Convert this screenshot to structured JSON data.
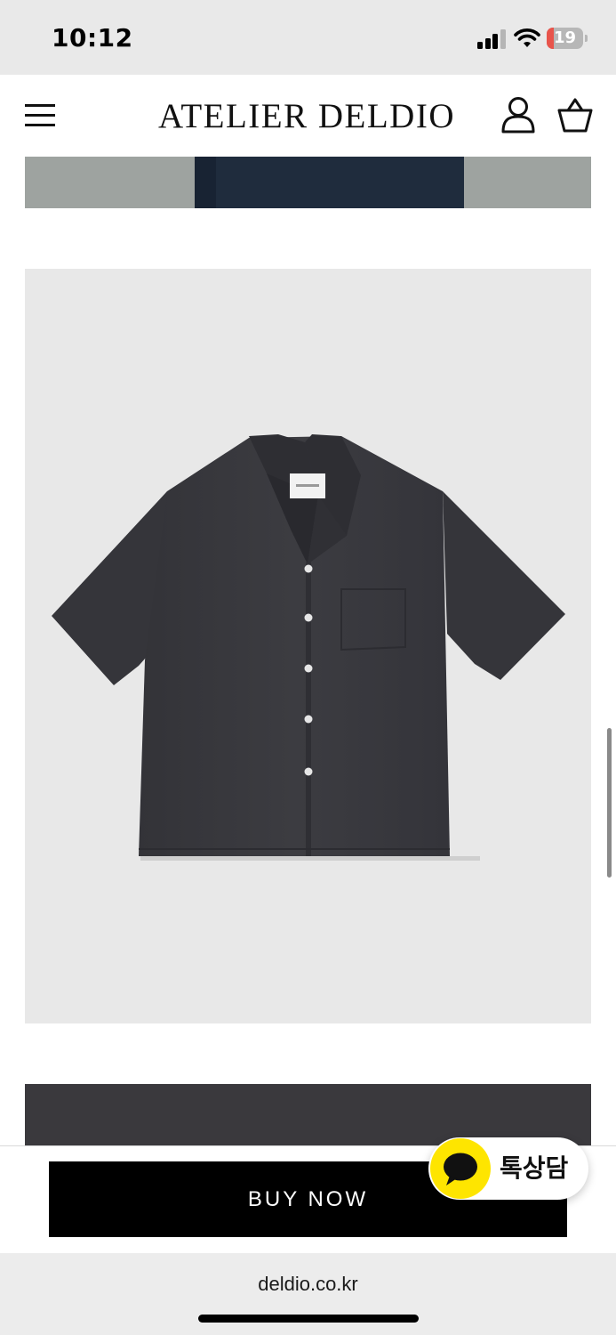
{
  "status_bar": {
    "time": "10:12",
    "battery_level": "19",
    "battery_fraction": 0.19,
    "battery_color": "#e8544b",
    "icons": [
      "signal-icon",
      "wifi-icon",
      "battery-icon"
    ]
  },
  "header": {
    "logo": "ATELIER DELDIO",
    "icons": [
      "menu-icon",
      "account-icon",
      "cart-icon"
    ]
  },
  "product_images": [
    {
      "name": "product-image-pants",
      "visible": "partial"
    },
    {
      "name": "product-image-shirt",
      "description_colors": {
        "background": "#e8e8e8",
        "garment": "#3a3a3f"
      }
    },
    {
      "name": "product-image-fabric-detail",
      "visible": "partial"
    }
  ],
  "buy_bar": {
    "buy_label": "BUY NOW"
  },
  "chat": {
    "label": "톡상담",
    "accent": "#fee500",
    "icon": "chat-bubble-icon"
  },
  "browser": {
    "url": "deldio.co.kr"
  }
}
